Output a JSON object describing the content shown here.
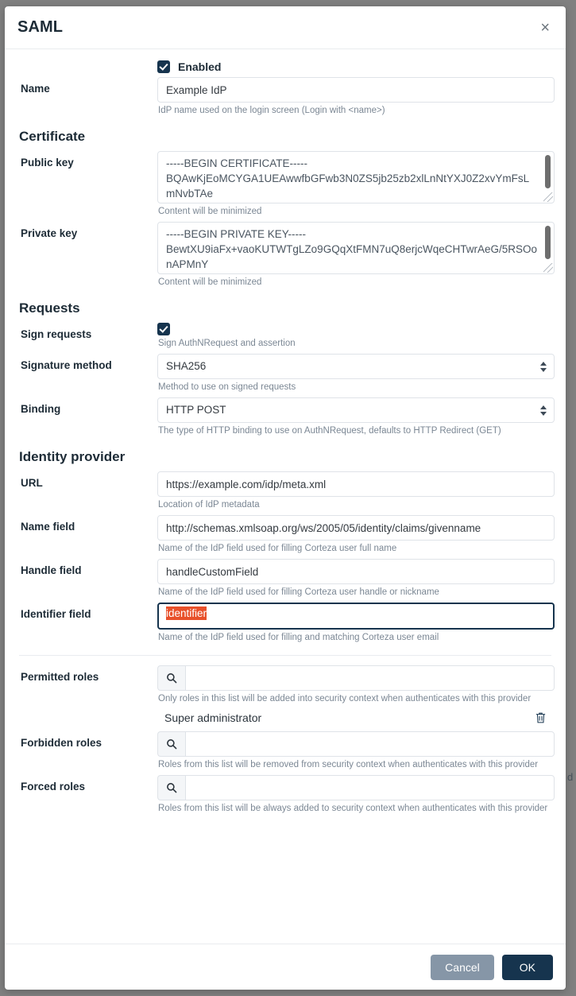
{
  "backdrop": {
    "color": "#808080",
    "clipped_text": "d\na"
  },
  "modal": {
    "title": "SAML",
    "close_label": "×"
  },
  "enabled": {
    "label": "Enabled",
    "checked": true
  },
  "fields": {
    "name": {
      "label": "Name",
      "value": "Example IdP",
      "help": "IdP name used on the login screen (Login with <name>)"
    }
  },
  "certificate": {
    "title": "Certificate",
    "public_key": {
      "label": "Public key",
      "value": "-----BEGIN CERTIFICATE-----\nBQAwKjEoMCYGA1UEAwwfbGFwb3N0ZS5jb25zb2xlLnNtYXJ0Z2xvYmFsLmNvbTAe",
      "help": "Content will be minimized"
    },
    "private_key": {
      "label": "Private key",
      "value": "-----BEGIN PRIVATE KEY-----\nBewtXU9iaFx+vaoKUTWTgLZo9GQqXtFMN7uQ8erjcWqeCHTwrAeG/5RSOonAPMnY",
      "help": "Content will be minimized"
    }
  },
  "requests": {
    "title": "Requests",
    "sign_requests": {
      "label": "Sign requests",
      "checked": true,
      "help": "Sign AuthNRequest and assertion"
    },
    "signature_method": {
      "label": "Signature method",
      "value": "SHA256",
      "options": [
        "SHA256"
      ],
      "help": "Method to use on signed requests"
    },
    "binding": {
      "label": "Binding",
      "value": "HTTP POST",
      "options": [
        "HTTP POST"
      ],
      "help": "The type of HTTP binding to use on AuthNRequest, defaults to HTTP Redirect (GET)"
    }
  },
  "identity_provider": {
    "title": "Identity provider",
    "url": {
      "label": "URL",
      "value": "https://example.com/idp/meta.xml",
      "help": "Location of IdP metadata"
    },
    "name_field": {
      "label": "Name field",
      "value": "http://schemas.xmlsoap.org/ws/2005/05/identity/claims/givenname",
      "help": "Name of the IdP field used for filling Corteza user full name"
    },
    "handle_field": {
      "label": "Handle field",
      "value": "handleCustomField",
      "help": "Name of the IdP field used for filling Corteza user handle or nickname"
    },
    "identifier_field": {
      "label": "Identifier field",
      "value": "identifier",
      "help": "Name of the IdP field used for filling and matching Corteza user email",
      "focused": true,
      "selection_color": "#e8502a"
    }
  },
  "roles": {
    "permitted": {
      "label": "Permitted roles",
      "search_value": "",
      "search_icon": "search-icon",
      "help": "Only roles in this list will be added into security context when authenticates with this provider",
      "items": [
        {
          "name": "Super administrator",
          "delete_icon": "trash-icon"
        }
      ]
    },
    "forbidden": {
      "label": "Forbidden roles",
      "search_value": "",
      "search_icon": "search-icon",
      "help": "Roles from this list will be removed from security context when authenticates with this provider",
      "items": []
    },
    "forced": {
      "label": "Forced roles",
      "search_value": "",
      "search_icon": "search-icon",
      "help": "Roles from this list will be always added to security context when authenticates with this provider",
      "items": []
    }
  },
  "footer": {
    "cancel_label": "Cancel",
    "ok_label": "OK",
    "cancel_color": "#8696a7",
    "ok_color": "#16344e"
  }
}
